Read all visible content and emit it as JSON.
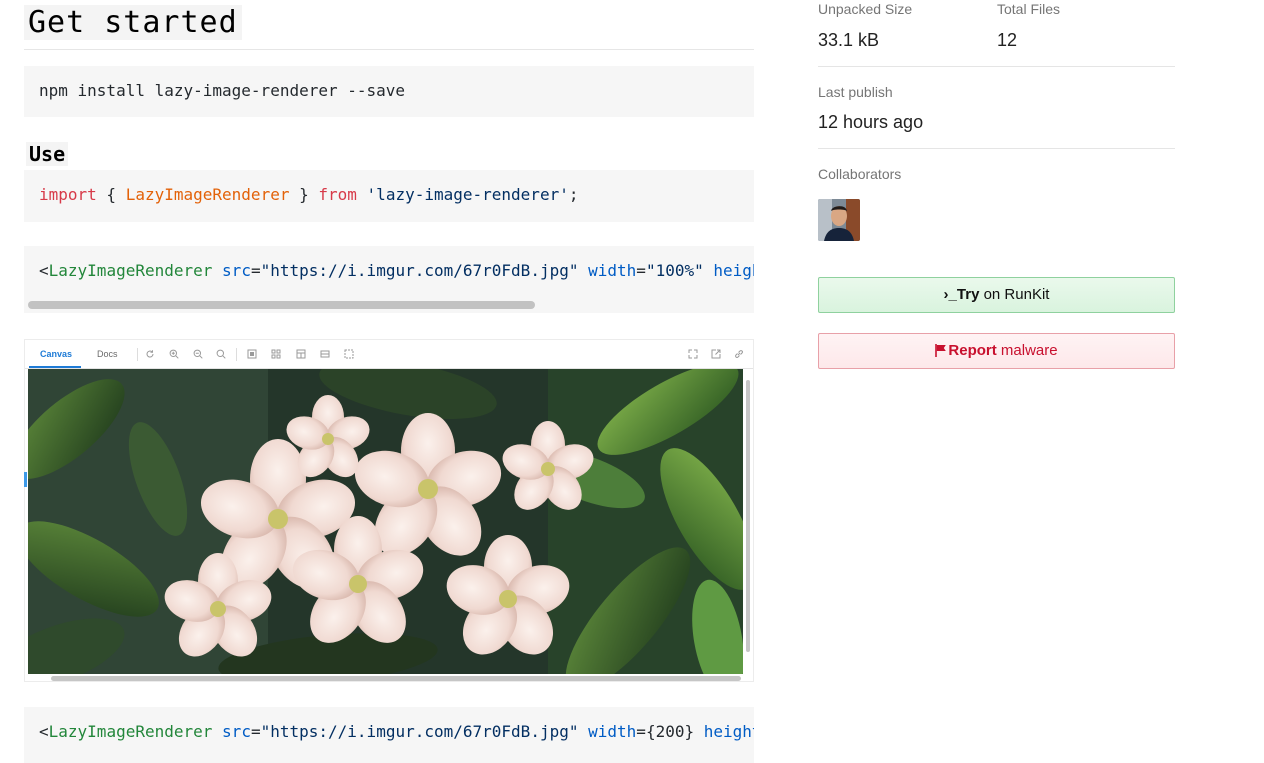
{
  "readme": {
    "get_started_heading": "Get started",
    "install_command": "npm install lazy-image-renderer --save",
    "use_heading": "Use",
    "import_line": {
      "keyword_import": "import",
      "brace_open": " { ",
      "identifier": "LazyImageRenderer",
      "brace_close": " } ",
      "keyword_from": "from",
      "space": " ",
      "module": "'lazy-image-renderer'",
      "semicolon": ";"
    },
    "example1": {
      "lt": "<",
      "tag": "LazyImageRenderer",
      "src_attr": "src",
      "src_eq": "=",
      "src_val": "\"https://i.imgur.com/67r0FdB.jpg\"",
      "width_attr": "width",
      "width_eq": "=",
      "width_val": "\"100%\"",
      "height_attr": "heigh"
    },
    "example2": {
      "lt": "<",
      "tag": "LazyImageRenderer",
      "src_attr": "src",
      "src_eq": "=",
      "src_val": "\"https://i.imgur.com/67r0FdB.jpg\"",
      "width_attr": "width",
      "width_eq": "=",
      "width_val": "{200}",
      "height_attr": "height"
    },
    "demo": {
      "tabs": [
        "Canvas",
        "Docs"
      ],
      "active_tab": "Canvas",
      "toolbar_icons": [
        "refresh-icon",
        "zoom-in-icon",
        "zoom-out-icon",
        "zoom-reset-icon",
        "grid-background-icon",
        "dotted-background-icon",
        "layout-icon",
        "stack-icon",
        "frame-icon",
        "fullscreen-icon",
        "open-external-icon",
        "copy-link-icon"
      ]
    }
  },
  "sidebar": {
    "unpacked_size_label": "Unpacked Size",
    "unpacked_size_value": "33.1 kB",
    "total_files_label": "Total Files",
    "total_files_value": "12",
    "last_publish_label": "Last publish",
    "last_publish_value": "12 hours ago",
    "collaborators_label": "Collaborators",
    "runkit_button": {
      "prompt": "›_",
      "bold": "Try",
      "rest": " on RunKit"
    },
    "malware_button": {
      "bold": "Report",
      "rest": " malware"
    }
  },
  "colors": {
    "keyword": "#d73a49",
    "identifier": "#e36209",
    "string": "#032f62",
    "jsx_tag": "#22863a",
    "jsx_attr": "#005cc5",
    "runkit_green": "#8fd19e",
    "malware_red": "#c8102e",
    "storybook_blue": "#1e7bd6"
  }
}
